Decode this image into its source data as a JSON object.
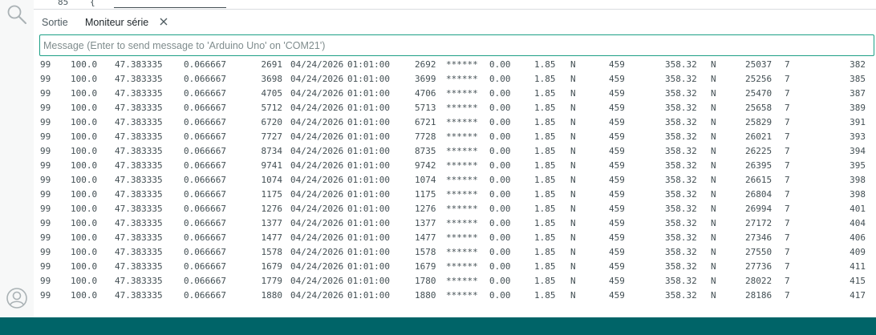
{
  "editor": {
    "line_number": "85",
    "code": "{"
  },
  "tabs": {
    "output": "Sortie",
    "serial_monitor": "Moniteur série"
  },
  "message_input": {
    "value": "",
    "placeholder": "Message (Enter to send message to 'Arduino Uno' on 'COM21')"
  },
  "icons": {
    "search": "search-icon",
    "account": "account-icon",
    "close": "close-icon"
  },
  "colors": {
    "accent": "#1da086",
    "status_bar": "#006468",
    "text": "#434f54"
  },
  "serial_lines": [
    [
      "99",
      "100.0",
      "47.383335",
      "0.066667",
      "2691",
      "04/24/2026",
      "01:01:00",
      "2692",
      "******",
      "0.00",
      "1.85",
      "N",
      "459",
      "358.32",
      "N",
      "25037",
      "7",
      "382"
    ],
    [
      "99",
      "100.0",
      "47.383335",
      "0.066667",
      "3698",
      "04/24/2026",
      "01:01:00",
      "3699",
      "******",
      "0.00",
      "1.85",
      "N",
      "459",
      "358.32",
      "N",
      "25256",
      "7",
      "385"
    ],
    [
      "99",
      "100.0",
      "47.383335",
      "0.066667",
      "4705",
      "04/24/2026",
      "01:01:00",
      "4706",
      "******",
      "0.00",
      "1.85",
      "N",
      "459",
      "358.32",
      "N",
      "25470",
      "7",
      "387"
    ],
    [
      "99",
      "100.0",
      "47.383335",
      "0.066667",
      "5712",
      "04/24/2026",
      "01:01:00",
      "5713",
      "******",
      "0.00",
      "1.85",
      "N",
      "459",
      "358.32",
      "N",
      "25658",
      "7",
      "389"
    ],
    [
      "99",
      "100.0",
      "47.383335",
      "0.066667",
      "6720",
      "04/24/2026",
      "01:01:00",
      "6721",
      "******",
      "0.00",
      "1.85",
      "N",
      "459",
      "358.32",
      "N",
      "25829",
      "7",
      "391"
    ],
    [
      "99",
      "100.0",
      "47.383335",
      "0.066667",
      "7727",
      "04/24/2026",
      "01:01:00",
      "7728",
      "******",
      "0.00",
      "1.85",
      "N",
      "459",
      "358.32",
      "N",
      "26021",
      "7",
      "393"
    ],
    [
      "99",
      "100.0",
      "47.383335",
      "0.066667",
      "8734",
      "04/24/2026",
      "01:01:00",
      "8735",
      "******",
      "0.00",
      "1.85",
      "N",
      "459",
      "358.32",
      "N",
      "26225",
      "7",
      "394"
    ],
    [
      "99",
      "100.0",
      "47.383335",
      "0.066667",
      "9741",
      "04/24/2026",
      "01:01:00",
      "9742",
      "******",
      "0.00",
      "1.85",
      "N",
      "459",
      "358.32",
      "N",
      "26395",
      "7",
      "395"
    ],
    [
      "99",
      "100.0",
      "47.383335",
      "0.066667",
      "1074",
      "04/24/2026",
      "01:01:00",
      "1074",
      "******",
      "0.00",
      "1.85",
      "N",
      "459",
      "358.32",
      "N",
      "26615",
      "7",
      "398"
    ],
    [
      "99",
      "100.0",
      "47.383335",
      "0.066667",
      "1175",
      "04/24/2026",
      "01:01:00",
      "1175",
      "******",
      "0.00",
      "1.85",
      "N",
      "459",
      "358.32",
      "N",
      "26804",
      "7",
      "398"
    ],
    [
      "99",
      "100.0",
      "47.383335",
      "0.066667",
      "1276",
      "04/24/2026",
      "01:01:00",
      "1276",
      "******",
      "0.00",
      "1.85",
      "N",
      "459",
      "358.32",
      "N",
      "26994",
      "7",
      "401"
    ],
    [
      "99",
      "100.0",
      "47.383335",
      "0.066667",
      "1377",
      "04/24/2026",
      "01:01:00",
      "1377",
      "******",
      "0.00",
      "1.85",
      "N",
      "459",
      "358.32",
      "N",
      "27172",
      "7",
      "404"
    ],
    [
      "99",
      "100.0",
      "47.383335",
      "0.066667",
      "1477",
      "04/24/2026",
      "01:01:00",
      "1477",
      "******",
      "0.00",
      "1.85",
      "N",
      "459",
      "358.32",
      "N",
      "27346",
      "7",
      "406"
    ],
    [
      "99",
      "100.0",
      "47.383335",
      "0.066667",
      "1578",
      "04/24/2026",
      "01:01:00",
      "1578",
      "******",
      "0.00",
      "1.85",
      "N",
      "459",
      "358.32",
      "N",
      "27550",
      "7",
      "409"
    ],
    [
      "99",
      "100.0",
      "47.383335",
      "0.066667",
      "1679",
      "04/24/2026",
      "01:01:00",
      "1679",
      "******",
      "0.00",
      "1.85",
      "N",
      "459",
      "358.32",
      "N",
      "27736",
      "7",
      "411"
    ],
    [
      "99",
      "100.0",
      "47.383335",
      "0.066667",
      "1779",
      "04/24/2026",
      "01:01:00",
      "1780",
      "******",
      "0.00",
      "1.85",
      "N",
      "459",
      "358.32",
      "N",
      "28022",
      "7",
      "415"
    ],
    [
      "99",
      "100.0",
      "47.383335",
      "0.066667",
      "1880",
      "04/24/2026",
      "01:01:00",
      "1880",
      "******",
      "0.00",
      "1.85",
      "N",
      "459",
      "358.32",
      "N",
      "28186",
      "7",
      "417"
    ]
  ]
}
